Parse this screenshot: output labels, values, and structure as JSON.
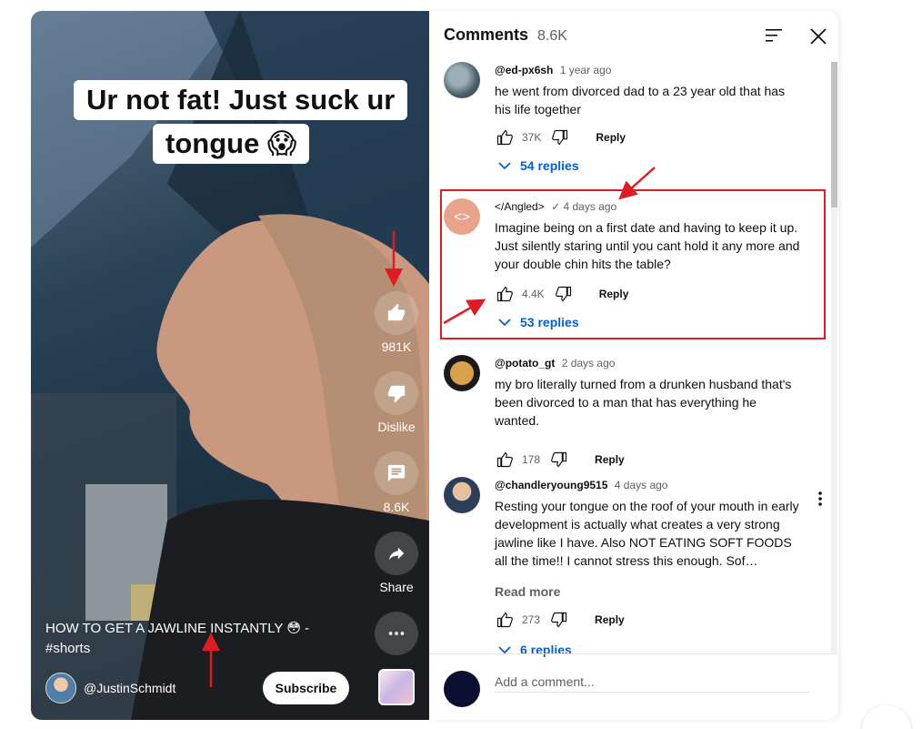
{
  "video": {
    "caption_line_1": "Ur not fat! Just suck ur",
    "caption_line_2": "tongue 😱",
    "like_count": "981K",
    "dislike_label": "Dislike",
    "comment_count": "8.6K",
    "share_label": "Share",
    "title": "HOW TO GET A JAWLINE INSTANTLY 😳 - #shorts",
    "channel_name": "@JustinSchmidt",
    "subscribe_label": "Subscribe"
  },
  "comments_panel": {
    "title": "Comments",
    "count": "8.6K",
    "comments": [
      {
        "author": "@ed-px6sh",
        "time": "1 year ago",
        "text": "he went from divorced dad to a 23 year old that has his life together",
        "likes": "37K",
        "reply_label": "Reply",
        "replies": "54 replies"
      },
      {
        "author": "</Angled>",
        "verified": "✓",
        "time": "4 days ago",
        "avatar_text": "<>",
        "text": "Imagine being on a first date and having to keep it up. Just silently staring until you cant hold it any more and your double chin hits the table?",
        "likes": "4.4K",
        "reply_label": "Reply",
        "replies": "53 replies"
      },
      {
        "author": "@potato_gt",
        "time": "2 days ago",
        "text": "my bro literally turned from a drunken husband that's been divorced to a man that has everything he wanted.",
        "likes": "178",
        "reply_label": "Reply"
      },
      {
        "author": "@chandleryoung9515",
        "time": "4 days ago",
        "text": "Resting your tongue on the roof of your mouth in early development is actually what creates a very strong jawline like I have. Also NOT EATING SOFT FOODS all the time!! I cannot stress this enough. Sof…",
        "read_more": "Read more",
        "likes": "273",
        "reply_label": "Reply",
        "replies": "6 replies"
      }
    ],
    "add_comment_placeholder": "Add a comment..."
  },
  "colors": {
    "accent_blue": "#065fd4",
    "highlight_red": "#e01b22"
  }
}
